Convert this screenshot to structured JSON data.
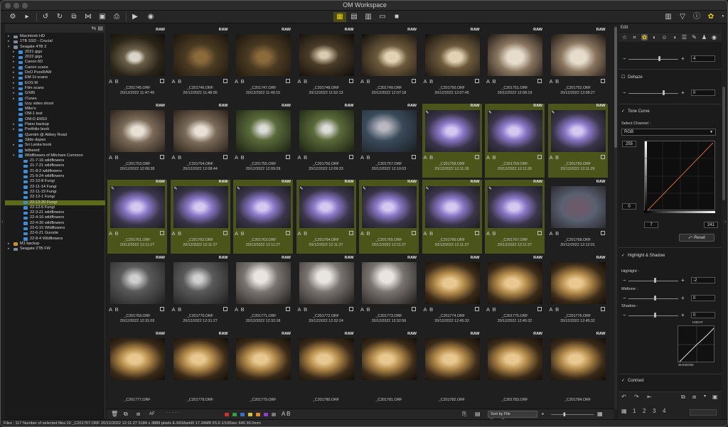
{
  "app": {
    "title": "OM Workspace"
  },
  "toolbar": {
    "left_icons": [
      "workspace-menu-icon",
      "folder-icon",
      "rotate-left-icon",
      "rotate-right-icon",
      "compare-icon",
      "select-icon",
      "print-icon",
      "dropdown-icon",
      "play-icon",
      "camera-icon"
    ],
    "view_icons": [
      "grid-view-icon",
      "list-view-icon",
      "film-strip-icon",
      "preview-icon",
      "single-view-icon"
    ],
    "right_icons": [
      "panels-icon",
      "filter-icon",
      "info-icon",
      "adjust-icon",
      "history-icon"
    ]
  },
  "browser": {
    "header": "",
    "tree": [
      {
        "label": "Macintosh HD",
        "level": 0,
        "kind": "drive",
        "exp": ">"
      },
      {
        "label": "1TB SSD - Crucial",
        "level": 0,
        "kind": "drive",
        "exp": ">"
      },
      {
        "label": "Seagate 4TB 2",
        "level": 0,
        "kind": "drive",
        "exp": "v"
      },
      {
        "label": "2021 gigs",
        "level": 1,
        "kind": "folder",
        "exp": ">"
      },
      {
        "label": "2022 gigs",
        "level": 1,
        "kind": "folder",
        "exp": ">"
      },
      {
        "label": "Canon 6D",
        "level": 1,
        "kind": "folder",
        "exp": ">"
      },
      {
        "label": "Canon scans",
        "level": 1,
        "kind": "folder",
        "exp": ">"
      },
      {
        "label": "DxO PureRAW",
        "level": 1,
        "kind": "folder",
        "exp": ">"
      },
      {
        "label": "EM-1ii scans",
        "level": 1,
        "kind": "folder",
        "exp": ">"
      },
      {
        "label": "EOS M",
        "level": 1,
        "kind": "folder",
        "exp": ">"
      },
      {
        "label": "Film scans",
        "level": 1,
        "kind": "folder",
        "exp": ">"
      },
      {
        "label": "GX85",
        "level": 1,
        "kind": "folder",
        "exp": ">"
      },
      {
        "label": "iTunes",
        "level": 1,
        "kind": "folder",
        "exp": ">"
      },
      {
        "label": "Izzy video shoot",
        "level": 1,
        "kind": "folder",
        "exp": ""
      },
      {
        "label": "Mike's",
        "level": 1,
        "kind": "folder",
        "exp": ""
      },
      {
        "label": "OM-1 test",
        "level": 1,
        "kind": "folder",
        "exp": ""
      },
      {
        "label": "OM-D EM10",
        "level": 1,
        "kind": "folder",
        "exp": ""
      },
      {
        "label": "Piano backup",
        "level": 1,
        "kind": "folder",
        "exp": ">"
      },
      {
        "label": "Portfolio book",
        "level": 1,
        "kind": "folder",
        "exp": ">"
      },
      {
        "label": "Quentin @ Abbey Road",
        "level": 1,
        "kind": "folder",
        "exp": ""
      },
      {
        "label": "Slide dupes",
        "level": 1,
        "kind": "folder",
        "exp": ""
      },
      {
        "label": "Sri Lanka book",
        "level": 1,
        "kind": "folder",
        "exp": ">"
      },
      {
        "label": "tethered",
        "level": 1,
        "kind": "folder",
        "exp": ""
      },
      {
        "label": "Wildflowers of Mitcham Common",
        "level": 1,
        "kind": "folder",
        "exp": "v"
      },
      {
        "label": "21-7-16 wildflowers",
        "level": 2,
        "kind": "folder",
        "exp": ""
      },
      {
        "label": "21-7-21 wildflowers",
        "level": 2,
        "kind": "folder",
        "exp": ""
      },
      {
        "label": "21-8-2 wildflowers",
        "level": 2,
        "kind": "folder",
        "exp": ""
      },
      {
        "label": "21-9-24 wildflowers",
        "level": 2,
        "kind": "folder",
        "exp": ""
      },
      {
        "label": "22-10-8 Fungi",
        "level": 2,
        "kind": "folder",
        "exp": ""
      },
      {
        "label": "22-11-14 Fungi",
        "level": 2,
        "kind": "folder",
        "exp": ""
      },
      {
        "label": "22-11-19 Fungi",
        "level": 2,
        "kind": "folder",
        "exp": ""
      },
      {
        "label": "22-12-1 Fungi",
        "level": 2,
        "kind": "folder",
        "exp": ""
      },
      {
        "label": "22-12-20 Fungi",
        "level": 2,
        "kind": "folder",
        "exp": "",
        "selected": true
      },
      {
        "label": "22-12-6 Fungi",
        "level": 2,
        "kind": "folder",
        "exp": ""
      },
      {
        "label": "22-3-21 wildflowers",
        "level": 2,
        "kind": "folder",
        "exp": ""
      },
      {
        "label": "22-4-16 wildflowers",
        "level": 2,
        "kind": "folder",
        "exp": ""
      },
      {
        "label": "22-4-30 wildflowers",
        "level": 2,
        "kind": "folder",
        "exp": ""
      },
      {
        "label": "22-6-15 Wildflowers",
        "level": 2,
        "kind": "folder",
        "exp": ""
      },
      {
        "label": "22-6-21 Gunsite",
        "level": 2,
        "kind": "folder",
        "exp": ""
      },
      {
        "label": "22-8-4 Wildflowers",
        "level": 2,
        "kind": "folder",
        "exp": ""
      },
      {
        "label": "M1 backup",
        "level": 0,
        "kind": "drive2",
        "exp": ">"
      },
      {
        "label": "Seagate 2TB FW",
        "level": 0,
        "kind": "drive",
        "exp": ">"
      }
    ]
  },
  "thumbnails": [
    {
      "name": "_C201745.ORF",
      "date": "20/12/2022 11:47:49",
      "sel": false,
      "edited": false,
      "tone": "a"
    },
    {
      "name": "_C201746.ORF",
      "date": "20/12/2022 11:48:00",
      "sel": false,
      "edited": false,
      "tone": "b"
    },
    {
      "name": "_C201747.ORF",
      "date": "20/12/2022 11:49:15",
      "sel": false,
      "edited": false,
      "tone": "b"
    },
    {
      "name": "_C201748.ORF",
      "date": "20/12/2022 11:52:13",
      "sel": false,
      "edited": false,
      "tone": "c"
    },
    {
      "name": "_C201749.ORF",
      "date": "20/12/2022 12:07:18",
      "sel": false,
      "edited": false,
      "tone": "d"
    },
    {
      "name": "_C201750.ORF",
      "date": "20/12/2022 12:07:45",
      "sel": false,
      "edited": false,
      "tone": "d"
    },
    {
      "name": "_C201751.ORF",
      "date": "20/12/2022 12:08:19",
      "sel": false,
      "edited": false,
      "tone": "e"
    },
    {
      "name": "_C201752.ORF",
      "date": "20/12/2022 12:08:27",
      "sel": false,
      "edited": false,
      "tone": "e"
    },
    {
      "name": "_C201753.ORF",
      "date": "20/12/2022 12:08:38",
      "sel": false,
      "edited": false,
      "tone": "f"
    },
    {
      "name": "_C201754.ORF",
      "date": "20/12/2022 12:08:44",
      "sel": false,
      "edited": false,
      "tone": "f"
    },
    {
      "name": "_C201755.ORF",
      "date": "20/12/2022 12:09:28",
      "sel": false,
      "edited": false,
      "tone": "g"
    },
    {
      "name": "_C201756.ORF",
      "date": "20/12/2022 12:09:33",
      "sel": false,
      "edited": false,
      "tone": "g"
    },
    {
      "name": "_C201757.ORF",
      "date": "20/12/2022 12:10:03",
      "sel": false,
      "edited": false,
      "tone": "h"
    },
    {
      "name": "_C201758.ORF",
      "date": "20/12/2022 12:11:26",
      "sel": true,
      "edited": true,
      "tone": "p"
    },
    {
      "name": "_C201759.ORF",
      "date": "20/12/2022 12:11:26",
      "sel": true,
      "edited": true,
      "tone": "p"
    },
    {
      "name": "_C201760.ORF",
      "date": "20/12/2022 12:11:26",
      "sel": true,
      "edited": true,
      "tone": "p"
    },
    {
      "name": "_C201761.ORF",
      "date": "20/12/2022 12:11:27",
      "sel": true,
      "edited": true,
      "tone": "p"
    },
    {
      "name": "_C201762.ORF",
      "date": "20/12/2022 12:11:27",
      "sel": true,
      "edited": true,
      "tone": "p"
    },
    {
      "name": "_C201763.ORF",
      "date": "20/12/2022 12:11:27",
      "sel": true,
      "edited": true,
      "tone": "p"
    },
    {
      "name": "_C201764.ORF",
      "date": "20/12/2022 12:11:27",
      "sel": true,
      "edited": true,
      "tone": "p"
    },
    {
      "name": "_C201765.ORF",
      "date": "20/12/2022 12:11:27",
      "sel": true,
      "edited": true,
      "tone": "p"
    },
    {
      "name": "_C201766.ORF",
      "date": "20/12/2022 12:11:27",
      "sel": true,
      "edited": true,
      "tone": "p"
    },
    {
      "name": "_C201767.ORF",
      "date": "20/12/2022 12:11:27",
      "sel": true,
      "edited": true,
      "tone": "p"
    },
    {
      "name": "_C201768.ORF",
      "date": "20/12/2022 12:12:01",
      "sel": false,
      "edited": false,
      "tone": "q"
    },
    {
      "name": "_C201769.ORF",
      "date": "20/12/2022 12:31:09",
      "sel": false,
      "edited": false,
      "tone": "r"
    },
    {
      "name": "_C201770.ORF",
      "date": "20/12/2022 12:31:27",
      "sel": false,
      "edited": false,
      "tone": "r"
    },
    {
      "name": "_C201771.ORF",
      "date": "20/12/2022 12:32:18",
      "sel": false,
      "edited": false,
      "tone": "s"
    },
    {
      "name": "_C201772.ORF",
      "date": "20/12/2022 12:32:24",
      "sel": false,
      "edited": false,
      "tone": "s"
    },
    {
      "name": "_C201773.ORF",
      "date": "20/12/2022 12:32:56",
      "sel": false,
      "edited": false,
      "tone": "s"
    },
    {
      "name": "_C201774.ORF",
      "date": "20/12/2022 12:45:32",
      "sel": false,
      "edited": false,
      "tone": "t"
    },
    {
      "name": "_C201775.ORF",
      "date": "20/12/2022 12:45:32",
      "sel": false,
      "edited": false,
      "tone": "t"
    },
    {
      "name": "_C201776.ORF",
      "date": "20/12/2022 12:45:32",
      "sel": false,
      "edited": false,
      "tone": "t"
    },
    {
      "name": "_C201777.ORF",
      "date": "",
      "sel": false,
      "edited": false,
      "tone": "t"
    },
    {
      "name": "_C201778.ORF",
      "date": "",
      "sel": false,
      "edited": false,
      "tone": "t"
    },
    {
      "name": "_C201779.ORF",
      "date": "",
      "sel": false,
      "edited": false,
      "tone": "t"
    },
    {
      "name": "_C201780.ORF",
      "date": "",
      "sel": false,
      "edited": false,
      "tone": "t"
    },
    {
      "name": "_C201781.ORF",
      "date": "",
      "sel": false,
      "edited": false,
      "tone": "t"
    },
    {
      "name": "_C201782.ORF",
      "date": "",
      "sel": false,
      "edited": false,
      "tone": "t"
    },
    {
      "name": "_C201783.ORF",
      "date": "",
      "sel": false,
      "edited": false,
      "tone": "t"
    },
    {
      "name": "_C201784.ORF",
      "date": "",
      "sel": false,
      "edited": false,
      "tone": "t"
    }
  ],
  "thumb_labels": {
    "raw": "RAW",
    "ab": "A B"
  },
  "bottombar": {
    "ab_label": "A B",
    "af_label": "AF",
    "sort_label": "Sort by File Name(Ascen...",
    "color_labels": [
      "#d02f2f",
      "#2ca63a",
      "#2f6fd6",
      "#d6c22f",
      "#e08a2a",
      "#8a3fd0",
      "#7a7a7a"
    ]
  },
  "status": "Files : 117   Number of selected files:10    _C201767.ORF   20/12/2022 12:11:27   5184 x 3888 pixels   E-M1MarkIII   17.34MB   F5.6   1/100sec   640   30.0mm",
  "edit": {
    "header": "Edit",
    "icons": [
      "star-icon",
      "crop-icon",
      "color-icon",
      "compare-icon",
      "face-icon",
      "tone-icon",
      "sliders-icon",
      "pen-icon",
      "stamp-icon",
      "eye-icon"
    ],
    "top_value": "4",
    "dehaze": {
      "title": "Dehaze",
      "value": "0"
    },
    "tone_curve": {
      "title": "Tone Curve",
      "channel_label": "Select Channel :",
      "channel": "RGB",
      "top_in": "255",
      "left_in": "0",
      "black_point": "7",
      "white_point": "241",
      "reset": "Reset"
    },
    "highlight_shadow": {
      "title": "Highlight & Shadow",
      "highlight_label": "Highlight :",
      "highlight_value": "-2",
      "midtone_label": "Midtone :",
      "midtone_value": "0",
      "shadow_label": "Shadow :",
      "shadow_value": "0",
      "graph_high": "HIGHT",
      "graph_shadow": "SHADOW"
    },
    "contrast": {
      "title": "Contrast"
    },
    "bottom_numbers": [
      "1",
      "2",
      "3",
      "4"
    ]
  }
}
